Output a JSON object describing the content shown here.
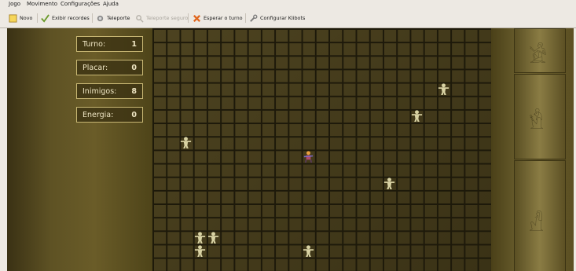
{
  "menu": [
    "Jogo",
    "Movimento",
    "Configurações",
    "Ajuda"
  ],
  "toolbar": {
    "new": "Novo",
    "scores": "Exibir recordes",
    "teleport": "Teleporte",
    "safe_teleport": "Teleporte seguro",
    "wait": "Esperar o turno",
    "configure": "Configurar Klibots"
  },
  "stats": {
    "turn_label": "Turno:",
    "turn": "1",
    "score_label": "Placar:",
    "score": "0",
    "enemies_label": "Inimigos:",
    "enemies": "8",
    "energy_label": "Energia:",
    "energy": "0"
  },
  "board": {
    "columns": 25,
    "rows": 18,
    "player": {
      "col": 11,
      "row": 9
    },
    "enemies": [
      {
        "col": 21,
        "row": 4
      },
      {
        "col": 19,
        "row": 6
      },
      {
        "col": 2,
        "row": 8
      },
      {
        "col": 17,
        "row": 11
      },
      {
        "col": 3,
        "row": 15
      },
      {
        "col": 4,
        "row": 15
      },
      {
        "col": 3,
        "row": 16
      },
      {
        "col": 11,
        "row": 16
      }
    ]
  },
  "colors": {
    "panel_border": "#c8b774",
    "panel_text": "#efe6c4",
    "enemy": "#d9d3a4",
    "player": "#b04a6a"
  }
}
